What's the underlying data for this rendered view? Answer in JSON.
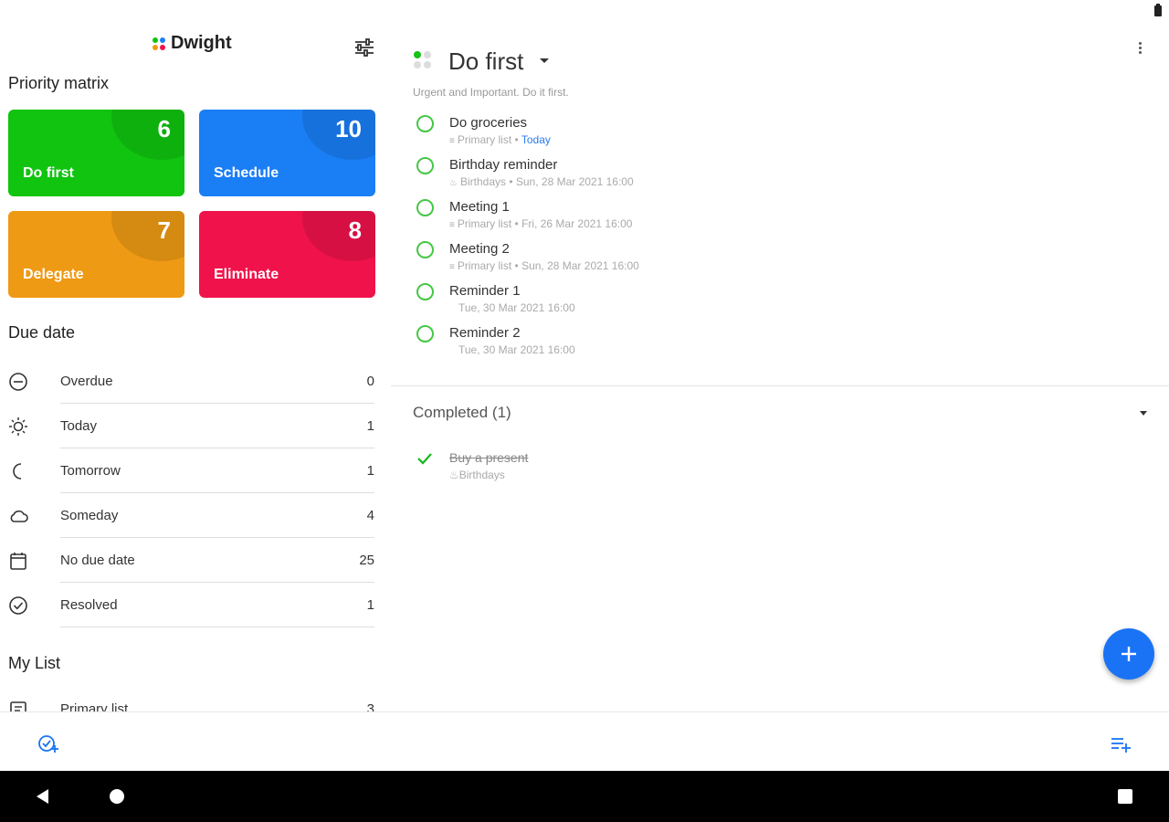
{
  "app": {
    "name": "Dwight"
  },
  "colors": {
    "do_first": "#10c410",
    "schedule": "#1a7ef5",
    "delegate": "#ee9a14",
    "eliminate": "#f0124b",
    "accent": "#1a73f5"
  },
  "left": {
    "priority_title": "Priority matrix",
    "tiles": [
      {
        "label": "Do first",
        "count": "6"
      },
      {
        "label": "Schedule",
        "count": "10"
      },
      {
        "label": "Delegate",
        "count": "7"
      },
      {
        "label": "Eliminate",
        "count": "8"
      }
    ],
    "due_title": "Due date",
    "due": [
      {
        "label": "Overdue",
        "count": "0",
        "icon": "minus-circle-icon"
      },
      {
        "label": "Today",
        "count": "1",
        "icon": "sun-icon"
      },
      {
        "label": "Tomorrow",
        "count": "1",
        "icon": "moon-icon"
      },
      {
        "label": "Someday",
        "count": "4",
        "icon": "cloud-icon"
      },
      {
        "label": "No due date",
        "count": "25",
        "icon": "calendar-icon"
      },
      {
        "label": "Resolved",
        "count": "1",
        "icon": "check-circle-icon"
      }
    ],
    "mylist_title": "My List",
    "lists": [
      {
        "label": "Primary list",
        "count": "3"
      }
    ]
  },
  "right": {
    "title": "Do first",
    "subtitle": "Urgent and Important. Do it first.",
    "tasks": [
      {
        "name": "Do groceries",
        "list": "Primary list",
        "sep": " • ",
        "date": "Today"
      },
      {
        "name": "Birthday reminder",
        "list": "Birthdays",
        "sep": " • ",
        "date": "Sun, 28 Mar 2021 16:00"
      },
      {
        "name": "Meeting 1",
        "list": "Primary list",
        "sep": " • ",
        "date": "Fri, 26 Mar 2021 16:00"
      },
      {
        "name": "Meeting 2",
        "list": "Primary list",
        "sep": " • ",
        "date": "Sun, 28 Mar 2021 16:00"
      },
      {
        "name": "Reminder 1",
        "date": "Tue, 30 Mar 2021 16:00"
      },
      {
        "name": "Reminder 2",
        "date": "Tue, 30 Mar 2021 16:00"
      }
    ],
    "completed_title": "Completed (1)",
    "completed": [
      {
        "name": "Buy a present",
        "list": "Birthdays"
      }
    ]
  }
}
